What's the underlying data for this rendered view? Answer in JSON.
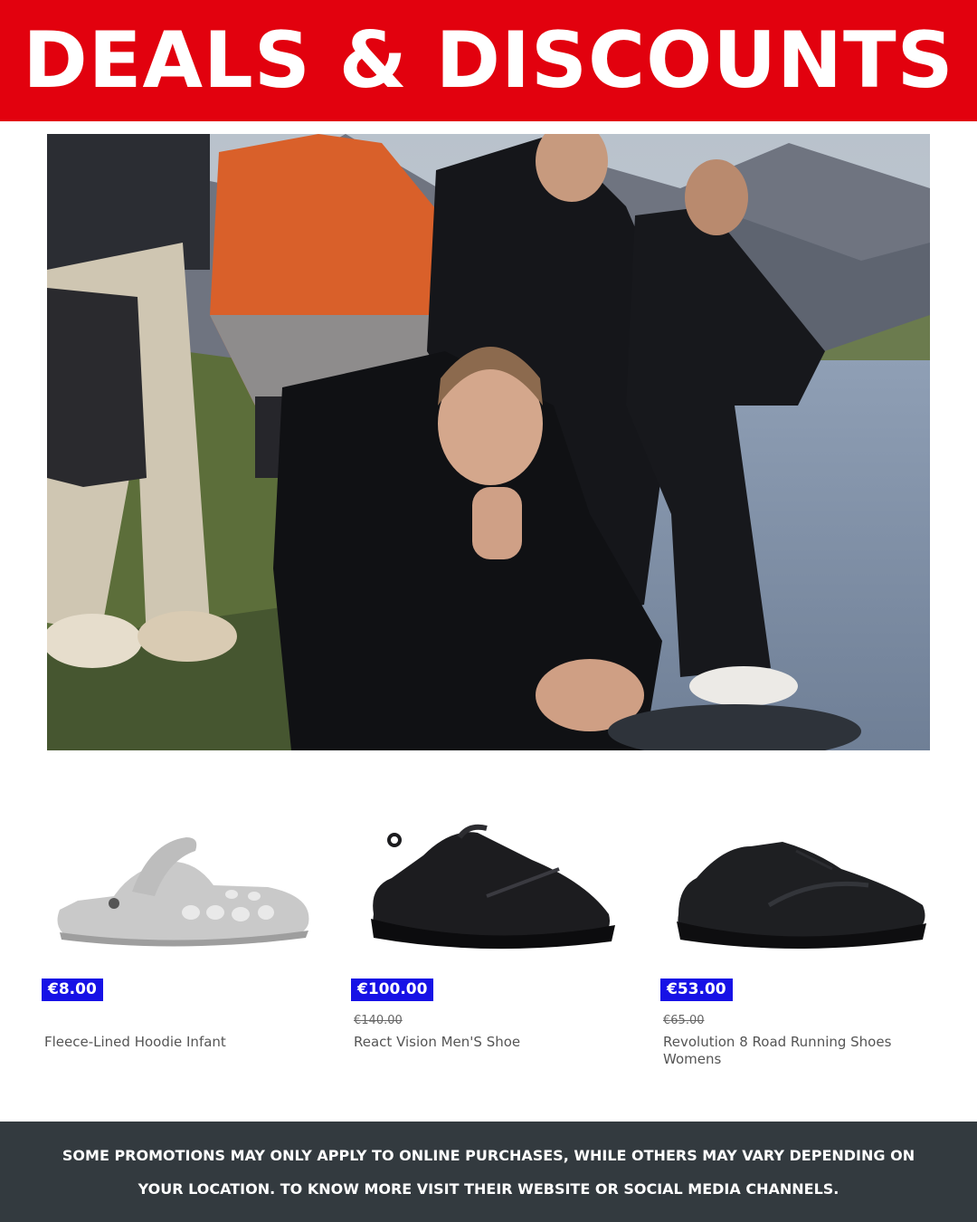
{
  "banner": {
    "title": "DEALS & DISCOUNTS",
    "color": "#e2010e"
  },
  "products": [
    {
      "price": "€8.00",
      "old_price": "",
      "name": "Fleece-Lined Hoodie Infant",
      "image": "grey-clog"
    },
    {
      "price": "€100.00",
      "old_price": "€140.00",
      "name": "React Vision Men'S Shoe",
      "image": "black-sneaker"
    },
    {
      "price": "€53.00",
      "old_price": "€65.00",
      "name": "Revolution 8 Road Running Shoes Womens",
      "image": "black-running-shoe"
    }
  ],
  "footer": {
    "text": "SOME PROMOTIONS MAY ONLY APPLY TO ONLINE PURCHASES, WHILE OTHERS MAY VARY DEPENDING ON YOUR LOCATION. TO KNOW MORE VISIT THEIR WEBSITE OR SOCIAL MEDIA CHANNELS.",
    "color": "#333a3f"
  },
  "price_tag_color": "#1712e6"
}
